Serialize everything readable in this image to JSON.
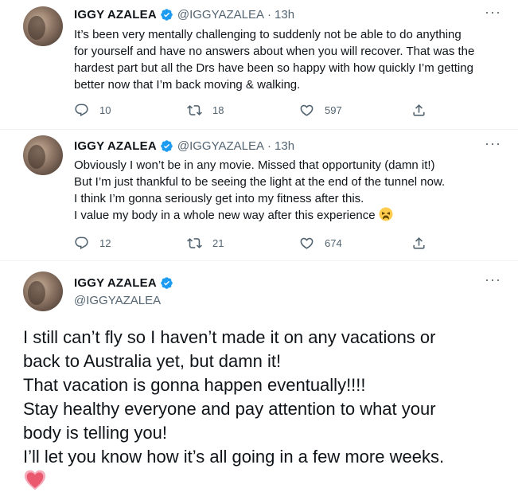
{
  "tweets": [
    {
      "name": "IGGY AZALEA",
      "handle": "@IGGYAZALEA",
      "separator": "·",
      "time": "13h",
      "lines": [
        "It’s been very mentally challenging to suddenly not be able to do anything",
        "for yourself and have no answers about when you will recover. That was the",
        "hardest part but all the Drs have been so happy with how quickly I’m getting",
        "better now that I’m back moving & walking."
      ],
      "replies": "10",
      "retweets": "18",
      "likes": "597"
    },
    {
      "name": "IGGY AZALEA",
      "handle": "@IGGYAZALEA",
      "separator": "·",
      "time": "13h",
      "lines": [
        "Obviously I won’t be in any movie. Missed that opportunity (damn it!)",
        "But I’m just thankful to be seeing the light at the end of the tunnel now.",
        "I think I’m gonna seriously get into my fitness after this.",
        "I value my body in a whole new way after this experience"
      ],
      "emoji": "weary-face-emoji",
      "replies": "12",
      "retweets": "21",
      "likes": "674"
    },
    {
      "name": "IGGY AZALEA",
      "handle": "@IGGYAZALEA",
      "lines": [
        "I still can’t fly so I haven’t made it on any vacations or",
        "back to Australia yet, but damn it!",
        "That vacation is gonna happen eventually!!!!",
        "Stay healthy everyone and pay attention to what your",
        "body is telling you!",
        "I’ll let you know how it’s all going in a few more weeks."
      ],
      "emoji": "heart-emoji"
    }
  ],
  "colors": {
    "text": "#0f1419",
    "secondary": "#536471",
    "verified": "#1d9bf0",
    "divider": "#eff3f4"
  },
  "icons": {
    "reply": "reply-icon",
    "retweet": "retweet-icon",
    "like": "like-icon",
    "share": "share-icon",
    "more": "more-icon",
    "verified": "verified-badge-icon"
  }
}
